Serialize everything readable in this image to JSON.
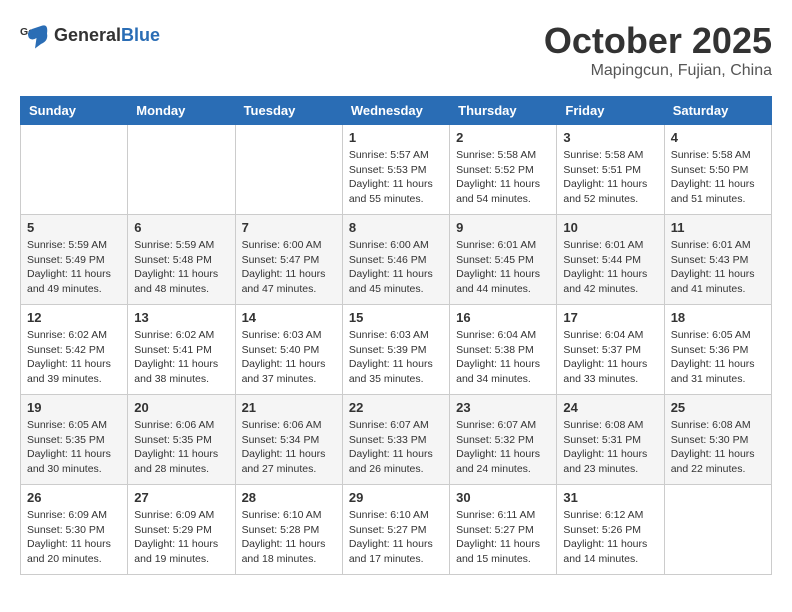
{
  "header": {
    "logo": {
      "general": "General",
      "blue": "Blue"
    },
    "title": "October 2025",
    "location": "Mapingcun, Fujian, China"
  },
  "calendar": {
    "days_of_week": [
      "Sunday",
      "Monday",
      "Tuesday",
      "Wednesday",
      "Thursday",
      "Friday",
      "Saturday"
    ],
    "weeks": [
      [
        {
          "day": "",
          "info": ""
        },
        {
          "day": "",
          "info": ""
        },
        {
          "day": "",
          "info": ""
        },
        {
          "day": "1",
          "info": "Sunrise: 5:57 AM\nSunset: 5:53 PM\nDaylight: 11 hours and 55 minutes."
        },
        {
          "day": "2",
          "info": "Sunrise: 5:58 AM\nSunset: 5:52 PM\nDaylight: 11 hours and 54 minutes."
        },
        {
          "day": "3",
          "info": "Sunrise: 5:58 AM\nSunset: 5:51 PM\nDaylight: 11 hours and 52 minutes."
        },
        {
          "day": "4",
          "info": "Sunrise: 5:58 AM\nSunset: 5:50 PM\nDaylight: 11 hours and 51 minutes."
        }
      ],
      [
        {
          "day": "5",
          "info": "Sunrise: 5:59 AM\nSunset: 5:49 PM\nDaylight: 11 hours and 49 minutes."
        },
        {
          "day": "6",
          "info": "Sunrise: 5:59 AM\nSunset: 5:48 PM\nDaylight: 11 hours and 48 minutes."
        },
        {
          "day": "7",
          "info": "Sunrise: 6:00 AM\nSunset: 5:47 PM\nDaylight: 11 hours and 47 minutes."
        },
        {
          "day": "8",
          "info": "Sunrise: 6:00 AM\nSunset: 5:46 PM\nDaylight: 11 hours and 45 minutes."
        },
        {
          "day": "9",
          "info": "Sunrise: 6:01 AM\nSunset: 5:45 PM\nDaylight: 11 hours and 44 minutes."
        },
        {
          "day": "10",
          "info": "Sunrise: 6:01 AM\nSunset: 5:44 PM\nDaylight: 11 hours and 42 minutes."
        },
        {
          "day": "11",
          "info": "Sunrise: 6:01 AM\nSunset: 5:43 PM\nDaylight: 11 hours and 41 minutes."
        }
      ],
      [
        {
          "day": "12",
          "info": "Sunrise: 6:02 AM\nSunset: 5:42 PM\nDaylight: 11 hours and 39 minutes."
        },
        {
          "day": "13",
          "info": "Sunrise: 6:02 AM\nSunset: 5:41 PM\nDaylight: 11 hours and 38 minutes."
        },
        {
          "day": "14",
          "info": "Sunrise: 6:03 AM\nSunset: 5:40 PM\nDaylight: 11 hours and 37 minutes."
        },
        {
          "day": "15",
          "info": "Sunrise: 6:03 AM\nSunset: 5:39 PM\nDaylight: 11 hours and 35 minutes."
        },
        {
          "day": "16",
          "info": "Sunrise: 6:04 AM\nSunset: 5:38 PM\nDaylight: 11 hours and 34 minutes."
        },
        {
          "day": "17",
          "info": "Sunrise: 6:04 AM\nSunset: 5:37 PM\nDaylight: 11 hours and 33 minutes."
        },
        {
          "day": "18",
          "info": "Sunrise: 6:05 AM\nSunset: 5:36 PM\nDaylight: 11 hours and 31 minutes."
        }
      ],
      [
        {
          "day": "19",
          "info": "Sunrise: 6:05 AM\nSunset: 5:35 PM\nDaylight: 11 hours and 30 minutes."
        },
        {
          "day": "20",
          "info": "Sunrise: 6:06 AM\nSunset: 5:35 PM\nDaylight: 11 hours and 28 minutes."
        },
        {
          "day": "21",
          "info": "Sunrise: 6:06 AM\nSunset: 5:34 PM\nDaylight: 11 hours and 27 minutes."
        },
        {
          "day": "22",
          "info": "Sunrise: 6:07 AM\nSunset: 5:33 PM\nDaylight: 11 hours and 26 minutes."
        },
        {
          "day": "23",
          "info": "Sunrise: 6:07 AM\nSunset: 5:32 PM\nDaylight: 11 hours and 24 minutes."
        },
        {
          "day": "24",
          "info": "Sunrise: 6:08 AM\nSunset: 5:31 PM\nDaylight: 11 hours and 23 minutes."
        },
        {
          "day": "25",
          "info": "Sunrise: 6:08 AM\nSunset: 5:30 PM\nDaylight: 11 hours and 22 minutes."
        }
      ],
      [
        {
          "day": "26",
          "info": "Sunrise: 6:09 AM\nSunset: 5:30 PM\nDaylight: 11 hours and 20 minutes."
        },
        {
          "day": "27",
          "info": "Sunrise: 6:09 AM\nSunset: 5:29 PM\nDaylight: 11 hours and 19 minutes."
        },
        {
          "day": "28",
          "info": "Sunrise: 6:10 AM\nSunset: 5:28 PM\nDaylight: 11 hours and 18 minutes."
        },
        {
          "day": "29",
          "info": "Sunrise: 6:10 AM\nSunset: 5:27 PM\nDaylight: 11 hours and 17 minutes."
        },
        {
          "day": "30",
          "info": "Sunrise: 6:11 AM\nSunset: 5:27 PM\nDaylight: 11 hours and 15 minutes."
        },
        {
          "day": "31",
          "info": "Sunrise: 6:12 AM\nSunset: 5:26 PM\nDaylight: 11 hours and 14 minutes."
        },
        {
          "day": "",
          "info": ""
        }
      ]
    ]
  }
}
